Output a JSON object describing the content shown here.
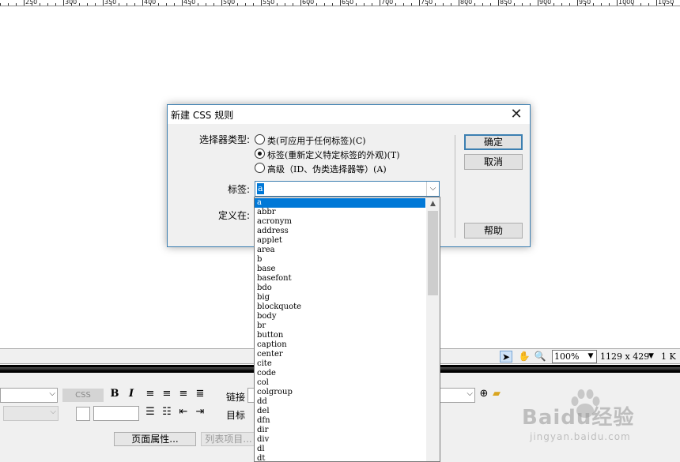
{
  "ruler": {
    "labels": [
      "250",
      "300",
      "350",
      "400",
      "450",
      "500",
      "550",
      "600",
      "650",
      "700",
      "750",
      "800",
      "850",
      "900",
      "950",
      "1000",
      "1050"
    ]
  },
  "status_bar": {
    "zoom": "100%",
    "dimensions": "1129 x 429",
    "size": "1 K"
  },
  "properties": {
    "css_button": "CSS",
    "bold": "B",
    "italic": "I",
    "link_label": "链接",
    "target_label": "目标",
    "page_props_button": "页面属性...",
    "list_item_button": "列表项目..."
  },
  "dialog": {
    "title": "新建 CSS 规则",
    "selector_type_label": "选择器类型:",
    "options": [
      {
        "label": "类(可应用于任何标签)(C)",
        "checked": false
      },
      {
        "label": "标签(重新定义特定标签的外观)(T)",
        "checked": true
      },
      {
        "label": "高级（ID、伪类选择器等）(A)",
        "checked": false
      }
    ],
    "tag_label": "标签:",
    "tag_value": "a",
    "define_in_label": "定义在:",
    "ok_button": "确定",
    "cancel_button": "取消",
    "help_button": "帮助"
  },
  "tag_list": {
    "items": [
      "a",
      "abbr",
      "acronym",
      "address",
      "applet",
      "area",
      "b",
      "base",
      "basefont",
      "bdo",
      "big",
      "blockquote",
      "body",
      "br",
      "button",
      "caption",
      "center",
      "cite",
      "code",
      "col",
      "colgroup",
      "dd",
      "del",
      "dfn",
      "dir",
      "div",
      "dl",
      "dt"
    ],
    "selected_index": 0
  },
  "watermark": {
    "brand": "Baidu经验",
    "url": "jingyan.baidu.com"
  }
}
